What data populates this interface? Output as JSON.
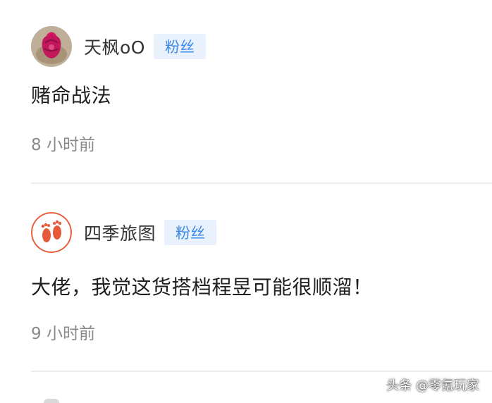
{
  "comments": [
    {
      "avatar_icon": "red-flower-avatar",
      "username": "天枫oO",
      "badge": "粉丝",
      "text": "赌命战法",
      "time": "8 小时前"
    },
    {
      "avatar_icon": "footprints-avatar",
      "username": "四季旅图",
      "badge": "粉丝",
      "text": "大佬，我觉这货搭档程昱可能很顺溜！",
      "time": "9 小时前"
    }
  ],
  "watermark": "头条 @零氪玩家",
  "colors": {
    "badge_bg": "#e8f1fc",
    "badge_text": "#3d8ae8",
    "time_text": "#8a8a8a",
    "divider": "#ececec"
  }
}
